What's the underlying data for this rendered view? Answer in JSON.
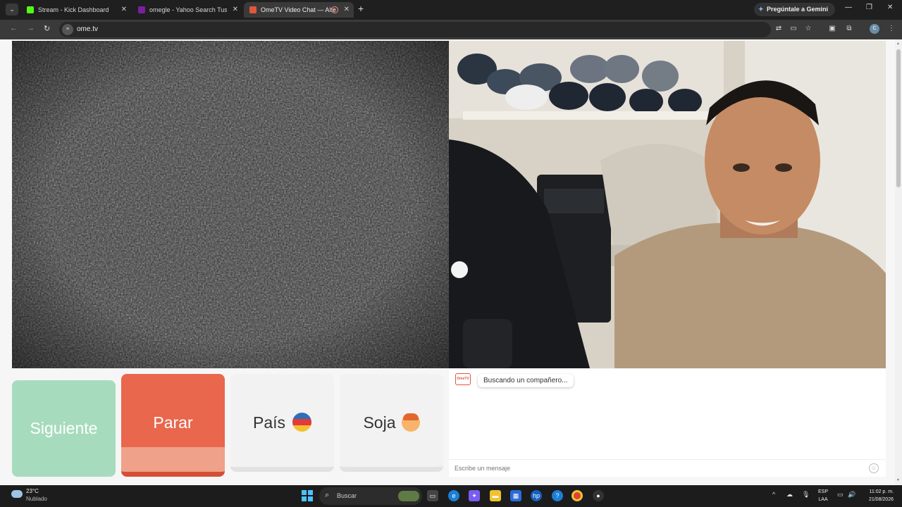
{
  "browser": {
    "tabs": [
      {
        "title": "Stream - Kick Dashboard",
        "favicon_color": "#53fc18",
        "active": false
      },
      {
        "title": "omegle - Yahoo Search Tus res",
        "favicon_color": "#7b1fa2",
        "active": false
      },
      {
        "title": "OmeTV Video Chat — Alte",
        "favicon_color": "#e1573b",
        "active": true
      }
    ],
    "new_tab_symbol": "+",
    "gemini_label": "Pregúntale a Gemini",
    "window_controls": {
      "minimize": "—",
      "restore": "❐",
      "close": "✕"
    },
    "url": "ome.tv",
    "site_icon_text": "≡",
    "profile_initial": "C"
  },
  "page": {
    "buttons": {
      "next": "Siguiente",
      "stop": "Parar",
      "country": "País",
      "gender": "Soja"
    },
    "country_flag_colors": [
      "#2e6fb8",
      "#e23a3a",
      "#f2c12e"
    ],
    "logo_text": "OmeTV",
    "status_message": "Buscando un compañero...",
    "message_placeholder": "Escribe un mensaje",
    "emoji_icon": "☺"
  },
  "taskbar": {
    "weather_temp": "23°C",
    "weather_condition": "Nublado",
    "search_label": "Buscar",
    "language": "ESP",
    "layout": "LAA",
    "time": "11:02 p. m.",
    "date": "21/08/2026"
  },
  "colors": {
    "next_button": "#a6dcbd",
    "stop_button": "#e8674d",
    "brand": "#e1573b"
  }
}
